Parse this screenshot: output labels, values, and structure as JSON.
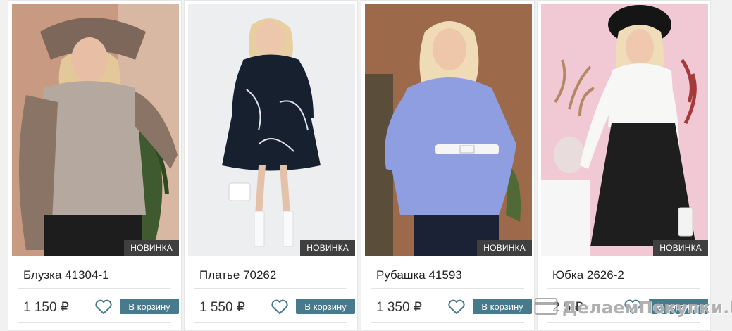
{
  "products": [
    {
      "title": "Блузка 41304-1",
      "price": "1 150 ₽",
      "badge": "НОВИНКА",
      "cart_label": "В корзину"
    },
    {
      "title": "Платье 70262",
      "price": "1 550 ₽",
      "badge": "НОВИНКА",
      "cart_label": "В корзину"
    },
    {
      "title": "Рубашка 41593",
      "price": "1 350 ₽",
      "badge": "НОВИНКА",
      "cart_label": "В корзину"
    },
    {
      "title": "Юбка 2626-2",
      "price": "2 5 ₽",
      "badge": "НОВИНКА",
      "cart_label": "В корзину"
    }
  ],
  "watermark": {
    "text": "ДелаемПокупки.Ру",
    "icon": "card-icon"
  },
  "colors": {
    "button": "#467a8c",
    "heart": "#467a8c",
    "badge": "#3f3f3f"
  }
}
